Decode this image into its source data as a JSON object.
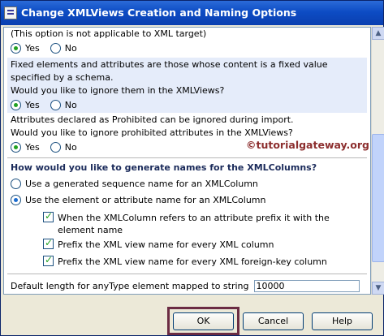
{
  "window": {
    "title": "Change XMLViews Creation and Naming Options"
  },
  "options": {
    "note_line": "(This option is not applicable to XML target)",
    "yes": "Yes",
    "no": "No",
    "fixed_line1": "Fixed elements and attributes are those whose content is a fixed value",
    "fixed_line2": "specified by a schema.",
    "fixed_line3": "Would you like to ignore them in the XMLViews?",
    "prohibited_line1": "Attributes declared as Prohibited can be ignored during import.",
    "prohibited_line2": "Would you like to ignore prohibited attributes in the XMLViews?",
    "q1_selected": "Yes",
    "q2_selected": "Yes",
    "q3_selected": "Yes"
  },
  "naming": {
    "heading": "How would you like to generate names for the XMLColumns?",
    "option_sequence": "Use a generated sequence name for an XMLColumn",
    "option_element": "Use the element or attribute name for an XMLColumn",
    "selected": "element",
    "checks": [
      {
        "label": "When the XMLColumn refers to an attribute prefix it with the element name",
        "checked": true
      },
      {
        "label": "Prefix the XML view name for every XML column",
        "checked": true
      },
      {
        "label": "Prefix the XML view name for every XML foreign-key column",
        "checked": true
      }
    ]
  },
  "default_length": {
    "label": "Default length for anyType element mapped to string",
    "value": "10000"
  },
  "watermark": "©tutorialgateway.org",
  "buttons": {
    "ok": "OK",
    "cancel": "Cancel",
    "help": "Help"
  }
}
